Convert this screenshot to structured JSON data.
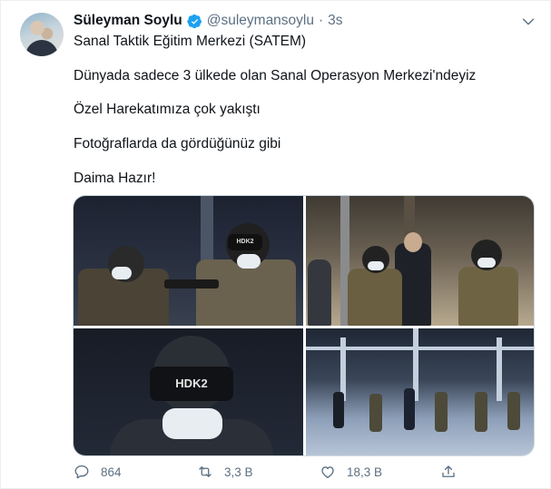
{
  "tweet": {
    "author_name": "Süleyman Soylu",
    "handle": "@suleymansoylu",
    "separator": "·",
    "time": "3s",
    "lines": [
      "Sanal Taktik Eğitim Merkezi (SATEM)",
      "Dünyada sadece 3 ülkede olan Sanal Operasyon Merkezi'ndeyiz",
      "Özel Harekatımıza çok yakıştı",
      "Fotoğraflarda da gördüğünüz gibi",
      "Daima Hazır!"
    ],
    "photo_labels": [
      "HDK2",
      "HDK2"
    ],
    "actions": {
      "reply_count": "864",
      "retweet_count": "3,3 B",
      "like_count": "18,3 B"
    },
    "icons": [
      "verified-badge-icon",
      "chevron-down-icon",
      "reply-icon",
      "retweet-icon",
      "like-icon",
      "share-icon"
    ],
    "colors": {
      "verified": "#1da1f2",
      "secondary_text": "#5b7083",
      "text": "#0f1419"
    }
  }
}
